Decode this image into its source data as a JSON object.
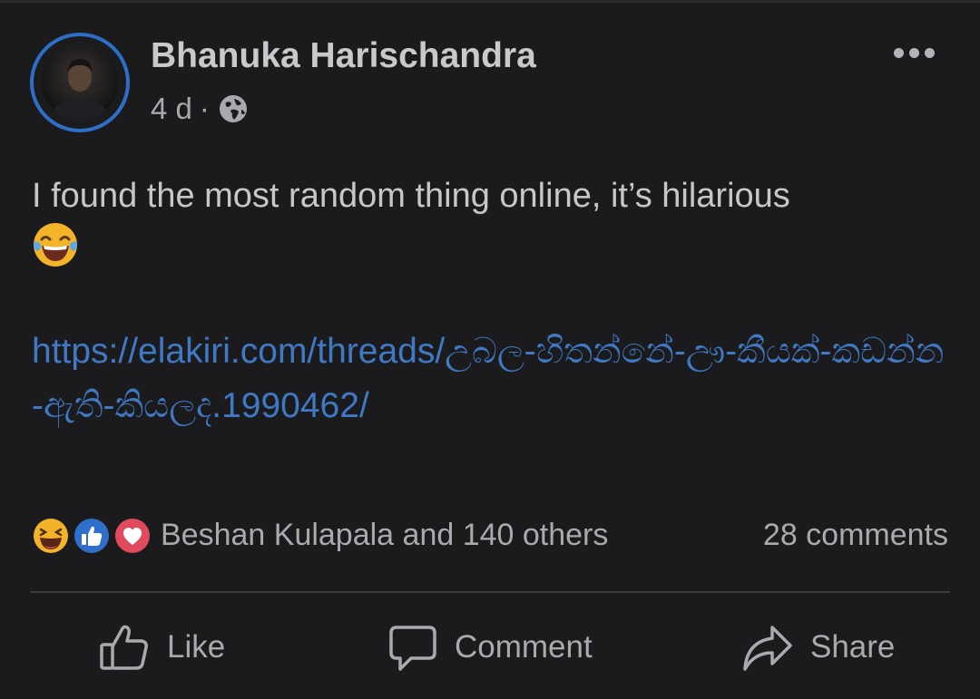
{
  "post": {
    "author": "Bhanuka Harischandra",
    "time": "4 d",
    "separator": "·",
    "privacy_icon": "globe-icon",
    "more_icon": "more-options-icon",
    "text": "I found the most random thing online, it’s hilarious",
    "emoji": "face-with-tears-of-joy",
    "link": "https://elakiri.com/threads/උබල-හිතන්නේ-ඌ-කීයක්-කඩන්න-ඇති-කියලද.1990462/"
  },
  "reactions": {
    "icons": [
      "haha-icon",
      "like-icon",
      "love-icon"
    ],
    "summary": "Beshan Kulapala and 140 others",
    "comments": "28 comments"
  },
  "actions": {
    "like": "Like",
    "comment": "Comment",
    "share": "Share"
  },
  "colors": {
    "background": "#1b1b1d",
    "link": "#3f79c4",
    "avatar_ring": "#2d6fc6"
  }
}
